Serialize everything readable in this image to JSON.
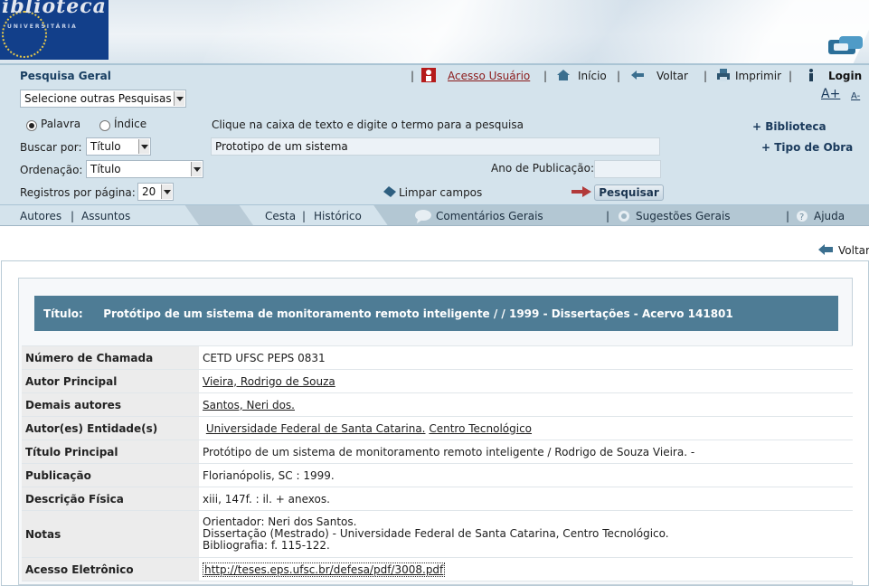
{
  "logo": {
    "word": "iblioteca",
    "sub": "UNIVERSITÁRIA"
  },
  "nav": {
    "title": "Pesquisa Geral",
    "acesso": "Acesso Usuário",
    "inicio": "Início",
    "voltar": "Voltar",
    "imprimir": "Imprimir",
    "login": "Login",
    "sep": "|"
  },
  "search": {
    "other_searches": "Selecione outras Pesquisas",
    "font_up": "A+",
    "font_down": "A-",
    "radio_palavra": "Palavra",
    "radio_indice": "Índice",
    "hint": "Clique na caixa de texto e digite o termo para a pesquisa",
    "buscar_label": "Buscar por:",
    "buscar_value": "Título",
    "query": "Prototipo de um sistema",
    "ordenacao_label": "Ordenação:",
    "ordenacao_value": "Título",
    "ano_label": "Ano de Publicação:",
    "ano_value": "",
    "registros_label": "Registros por página:",
    "registros_value": "20",
    "limpar": "Limpar campos",
    "pesquisar": "Pesquisar",
    "biblioteca": "+ Biblioteca",
    "tipo_obra": "+ Tipo de Obra"
  },
  "tabs": {
    "autores": "Autores",
    "assuntos": "Assuntos",
    "cesta": "Cesta",
    "historico": "Histórico",
    "comentarios": "Comentários Gerais",
    "sugestoes": "Sugestões Gerais",
    "ajuda": "Ajuda",
    "sep": "|"
  },
  "record": {
    "back": "Voltar",
    "title_label": "Título:",
    "title_value": "Protótipo de um sistema de monitoramento remoto inteligente / / 1999 - Dissertações - Acervo 141801",
    "rows": {
      "chamada_k": "Número de Chamada",
      "chamada_v": "CETD UFSC  PEPS  0831",
      "autor_k": "Autor Principal",
      "autor_v": "Vieira, Rodrigo de Souza",
      "demais_k": "Demais autores",
      "demais_v": "Santos, Neri dos.",
      "entidade_k": "Autor(es) Entidade(s)",
      "entidade_v1": "Universidade Federal de Santa Catarina.",
      "entidade_v2": "Centro Tecnológico",
      "titulo_k": "Título Principal",
      "titulo_v": "Protótipo de um sistema de monitoramento remoto inteligente /  Rodrigo de Souza Vieira. -",
      "publicacao_k": "Publicação",
      "publicacao_v": "Florianópolis, SC : 1999.",
      "descricao_k": "Descrição Física",
      "descricao_v": "xiii, 147f. : il. +  anexos.",
      "notas_k": "Notas",
      "notas_v1": "Orientador: Neri dos Santos.",
      "notas_v2": "Dissertação (Mestrado) - Universidade Federal de Santa Catarina, Centro Tecnológico.",
      "notas_v3": "Bibliografia: f. 115-122.",
      "acesso_k": "Acesso Eletrônico",
      "acesso_v": "http://teses.eps.ufsc.br/defesa/pdf/3008.pdf"
    }
  }
}
